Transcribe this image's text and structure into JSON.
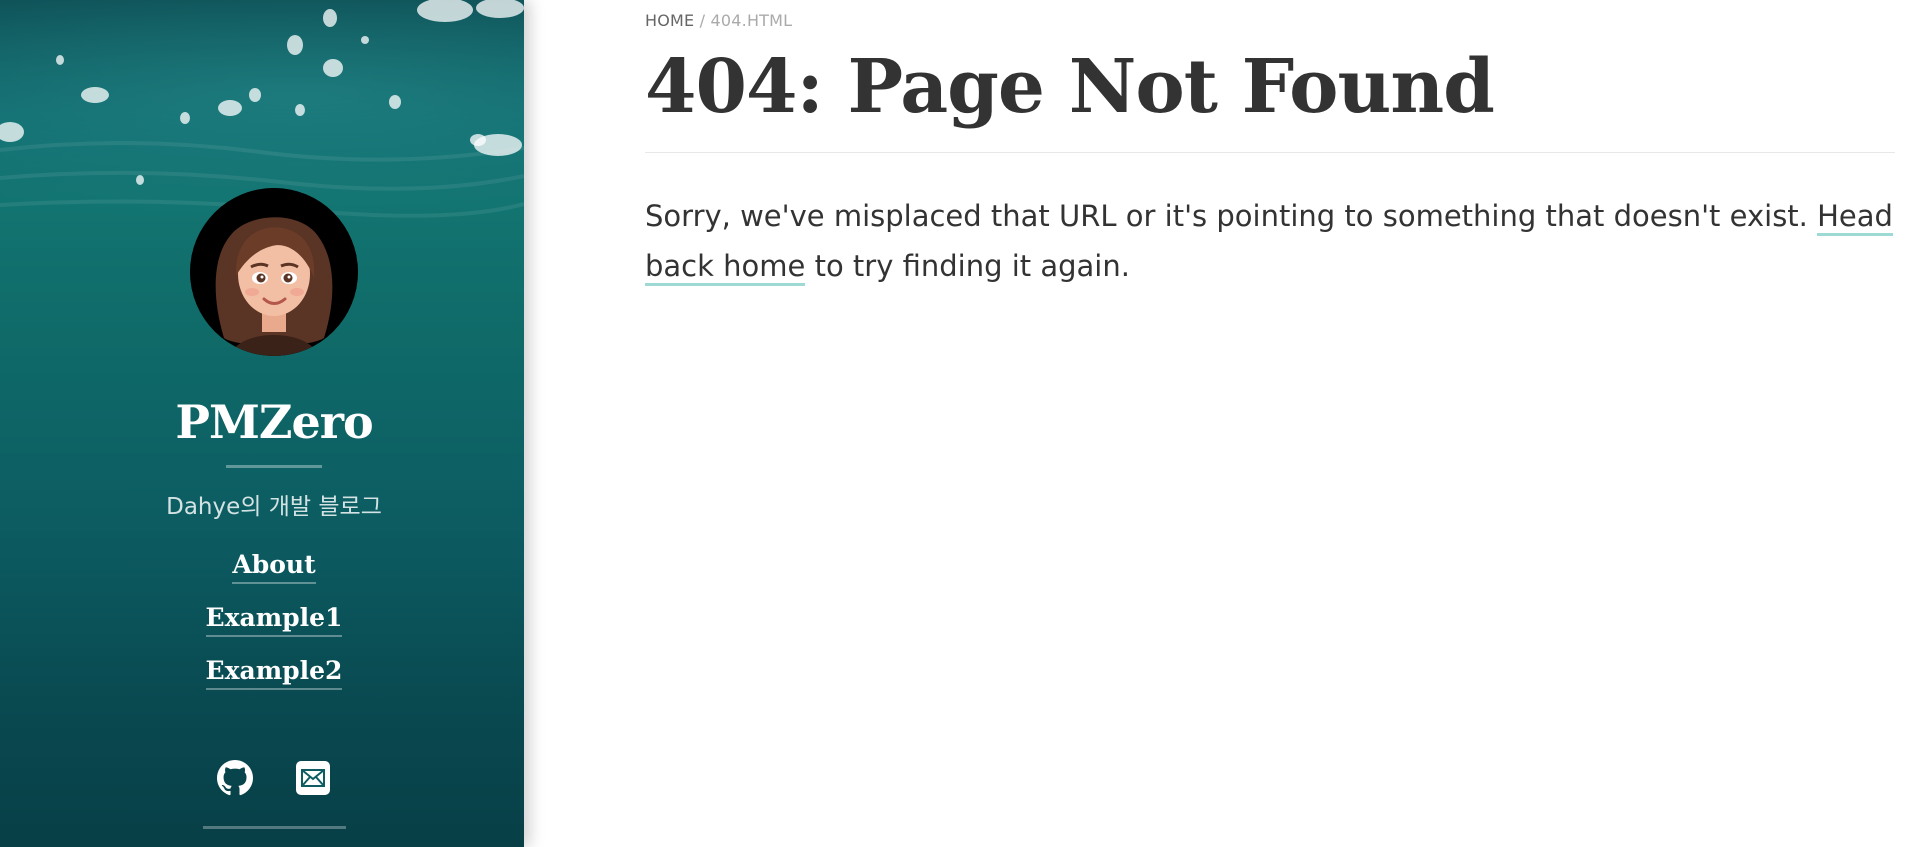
{
  "sidebar": {
    "title": "PMZero",
    "tagline": "Dahye의 개발 블로그",
    "nav": [
      {
        "label": "About"
      },
      {
        "label": "Example1"
      },
      {
        "label": "Example2"
      }
    ],
    "social": [
      {
        "icon": "github-icon"
      },
      {
        "icon": "email-icon"
      }
    ],
    "colors": {
      "background_top": "#0f6a6e",
      "background_bottom": "#083f47",
      "text": "#ffffff"
    }
  },
  "breadcrumb": {
    "home": "HOME",
    "separator": "/",
    "current": "404.HTML"
  },
  "page": {
    "title": "404: Page Not Found",
    "message_before": "Sorry, we've misplaced that URL or it's pointing to something that doesn't exist. ",
    "link_text": "Head back home",
    "message_after": " to try finding it again.",
    "link_underline_color": "#9fd9d3"
  }
}
